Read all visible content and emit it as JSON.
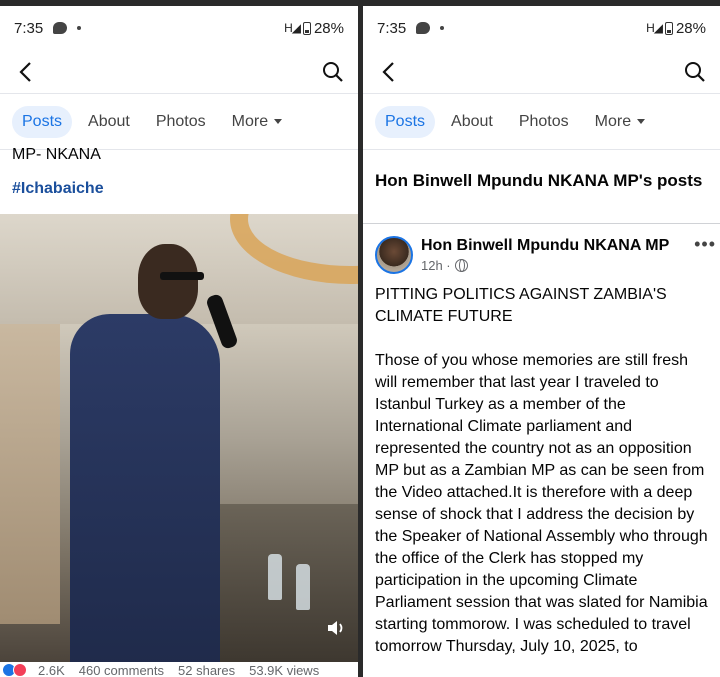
{
  "status_bar": {
    "time": "7:35",
    "dot": "•",
    "signal": "H",
    "battery": "28%"
  },
  "tabs": {
    "posts": "Posts",
    "about": "About",
    "photos": "Photos",
    "more": "More"
  },
  "left": {
    "cut_text": "MP- NKANA",
    "hashtag": "#Ichabaiche",
    "stats": {
      "reactions": "2.6K",
      "comments": "460 comments",
      "shares": "52 shares",
      "views": "53.9K views"
    }
  },
  "right": {
    "page_heading": "Hon Binwell Mpundu NKANA MP's posts",
    "author": "Hon Binwell Mpundu NKANA MP",
    "time": "12h ·",
    "more": "•••",
    "post_title": "PITTING  POLITICS AGAINST ZAMBIA'S CLIMATE FUTURE",
    "post_body": "Those of you whose memories are still fresh will remember that last year I traveled to Istanbul Turkey as a member of the International Climate parliament and represented the country not as an opposition MP but as a Zambian MP as can be seen from the Video attached.It is therefore with a deep sense of shock that I address the decision by the Speaker of National Assembly who through the office of the Clerk  has stopped my participation in the upcoming Climate Parliament session that was slated for Namibia starting tommorow. I was scheduled to travel tomorrow Thursday, July 10, 2025, to"
  },
  "colors": {
    "accent": "#1b74e4",
    "tab_active_bg": "#e7f0fd",
    "hashtag": "#1b4f9c"
  },
  "icons": [
    "back-arrow-icon",
    "search-icon",
    "chat-bubble-icon",
    "signal-icon",
    "battery-icon",
    "globe-icon",
    "sound-icon",
    "more-dots-icon",
    "caret-down-icon"
  ]
}
